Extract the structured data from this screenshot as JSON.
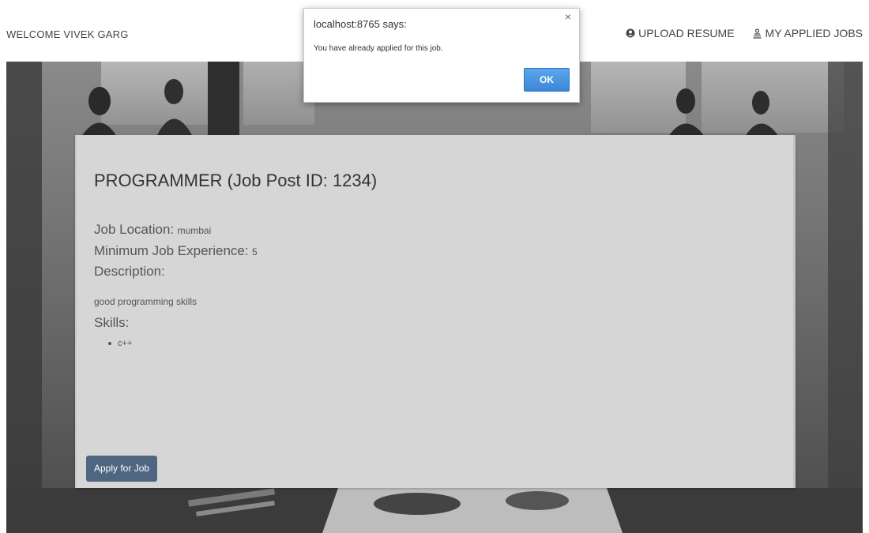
{
  "navbar": {
    "welcome": "WELCOME VIVEK GARG",
    "links": [
      {
        "label": "UPLOAD RESUME",
        "icon": "user-circle-icon"
      },
      {
        "label": "MY APPLIED JOBS",
        "icon": "applied-jobs-icon"
      }
    ]
  },
  "job": {
    "title": "PROGRAMMER (Job Post ID: 1234)",
    "location_label": "Job Location:",
    "location": "mumbai",
    "experience_label": "Minimum Job Experience:",
    "experience": "5",
    "description_label": "Description:",
    "description": "good programming skills",
    "skills_label": "Skills:",
    "skills": [
      "c++"
    ],
    "apply_label": "Apply for Job"
  },
  "dialog": {
    "title": "localhost:8765 says:",
    "message": "You have already applied for this job.",
    "close": "×",
    "ok_label": "OK"
  },
  "colors": {
    "card_bg": "#d6d6d6",
    "apply_button": "#4e6680",
    "ok_button": "#3d87d6"
  }
}
